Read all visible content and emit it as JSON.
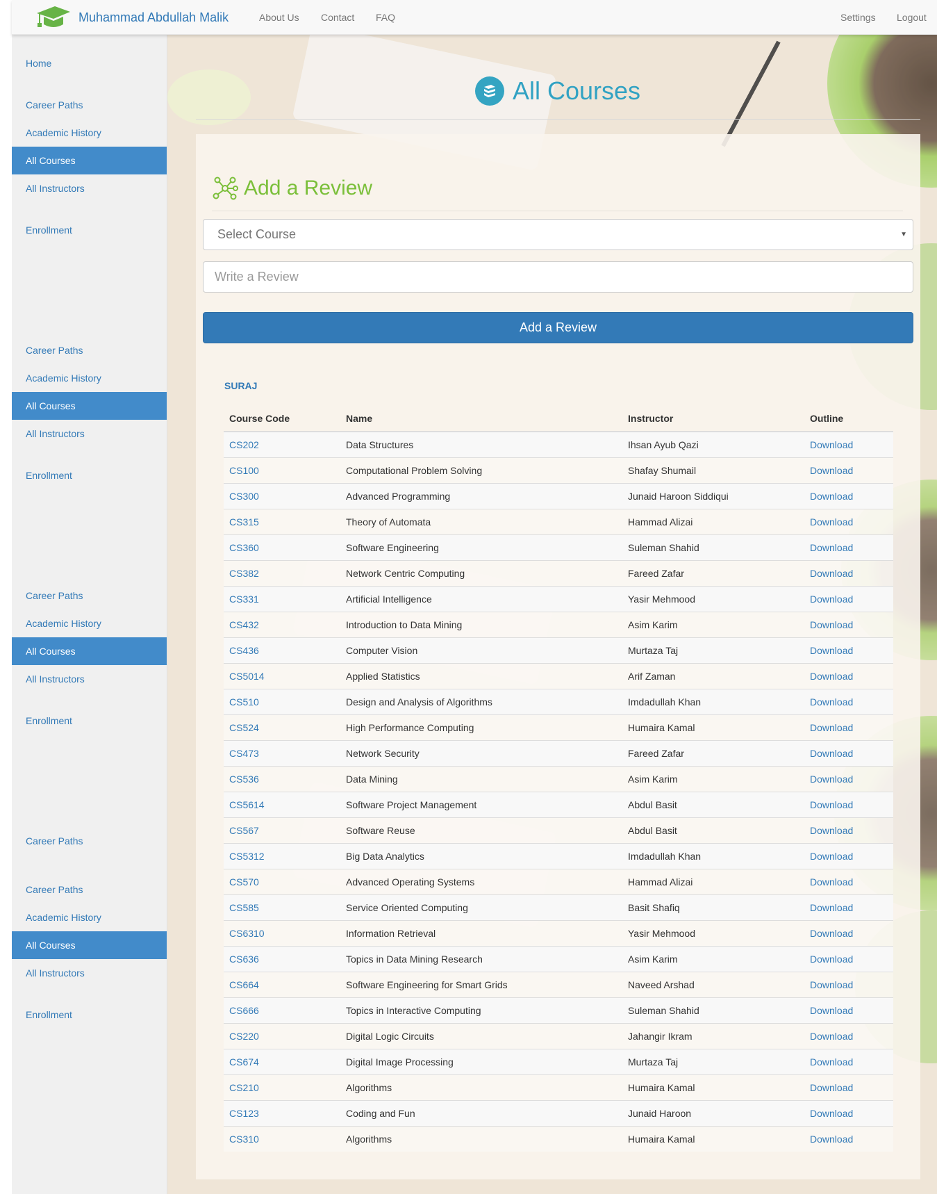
{
  "navbar": {
    "brand": "Muhammad Abdullah Malik",
    "links": [
      "About Us",
      "Contact",
      "FAQ"
    ],
    "right_links": [
      "Settings",
      "Logout"
    ]
  },
  "sidebar": {
    "home": "Home",
    "blocks": [
      [
        "Career Paths",
        "Academic History",
        "All Courses",
        "All Instructors",
        "Enrollment"
      ],
      [
        "Career Paths",
        "Academic History",
        "All Courses",
        "All Instructors",
        "Enrollment"
      ],
      [
        "Career Paths",
        "Academic History",
        "All Courses",
        "All Instructors",
        "Enrollment"
      ],
      [
        "Career Paths"
      ],
      [
        "Career Paths",
        "Academic History",
        "All Courses",
        "All Instructors",
        "Enrollment"
      ]
    ],
    "active": "All Courses"
  },
  "page": {
    "title": "All Courses",
    "review_heading": "Add a Review",
    "select_placeholder": "Select Course",
    "review_placeholder": "Write a Review",
    "add_button": "Add a Review",
    "user": "SURAJ"
  },
  "table": {
    "headers": [
      "Course Code",
      "Name",
      "Instructor",
      "Outline"
    ],
    "rows": [
      [
        "CS202",
        "Data Structures",
        "Ihsan Ayub Qazi",
        "Download"
      ],
      [
        "CS100",
        "Computational Problem Solving",
        "Shafay Shumail",
        "Download"
      ],
      [
        "CS300",
        "Advanced Programming",
        "Junaid Haroon Siddiqui",
        "Download"
      ],
      [
        "CS315",
        "Theory of Automata",
        "Hammad Alizai",
        "Download"
      ],
      [
        "CS360",
        "Software Engineering",
        "Suleman Shahid",
        "Download"
      ],
      [
        "CS382",
        "Network Centric Computing",
        "Fareed Zafar",
        "Download"
      ],
      [
        "CS331",
        "Artificial Intelligence",
        "Yasir Mehmood",
        "Download"
      ],
      [
        "CS432",
        "Introduction to Data Mining",
        "Asim Karim",
        "Download"
      ],
      [
        "CS436",
        "Computer Vision",
        "Murtaza Taj",
        "Download"
      ],
      [
        "CS5014",
        "Applied Statistics",
        "Arif Zaman",
        "Download"
      ],
      [
        "CS510",
        "Design and Analysis of Algorithms",
        "Imdadullah Khan",
        "Download"
      ],
      [
        "CS524",
        "High Performance Computing",
        "Humaira Kamal",
        "Download"
      ],
      [
        "CS473",
        "Network Security",
        "Fareed Zafar",
        "Download"
      ],
      [
        "CS536",
        "Data Mining",
        "Asim Karim",
        "Download"
      ],
      [
        "CS5614",
        "Software Project Management",
        "Abdul Basit",
        "Download"
      ],
      [
        "CS567",
        "Software Reuse",
        "Abdul Basit",
        "Download"
      ],
      [
        "CS5312",
        "Big Data Analytics",
        "Imdadullah Khan",
        "Download"
      ],
      [
        "CS570",
        "Advanced Operating Systems",
        "Hammad Alizai",
        "Download"
      ],
      [
        "CS585",
        "Service Oriented Computing",
        "Basit Shafiq",
        "Download"
      ],
      [
        "CS6310",
        "Information Retrieval",
        "Yasir Mehmood",
        "Download"
      ],
      [
        "CS636",
        "Topics in Data Mining Research",
        "Asim Karim",
        "Download"
      ],
      [
        "CS664",
        "Software Engineering for Smart Grids",
        "Naveed Arshad",
        "Download"
      ],
      [
        "CS666",
        "Topics in Interactive Computing",
        "Suleman Shahid",
        "Download"
      ],
      [
        "CS220",
        "Digital Logic Circuits",
        "Jahangir Ikram",
        "Download"
      ],
      [
        "CS674",
        "Digital Image Processing",
        "Murtaza Taj",
        "Download"
      ],
      [
        "CS210",
        "Algorithms",
        "Humaira Kamal",
        "Download"
      ],
      [
        "CS123",
        "Coding and Fun",
        "Junaid Haroon",
        "Download"
      ],
      [
        "CS310",
        "Algorithms",
        "Humaira Kamal",
        "Download"
      ]
    ]
  },
  "colors": {
    "brand_blue": "#337ab7",
    "active_item": "#428bca",
    "title_teal": "#31a2c3",
    "review_green": "#7bbf3a"
  },
  "icons": {
    "brand": "graduation-cap-icon",
    "page": "book-icon",
    "review": "network-nodes-icon"
  }
}
